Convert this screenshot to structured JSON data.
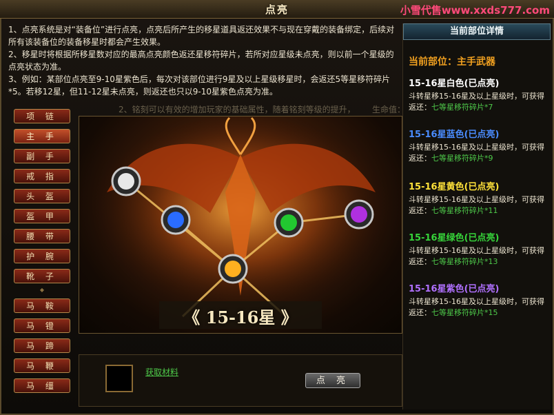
{
  "window": {
    "title": "点亮",
    "watermark": "小雪代售www.xxds777.com"
  },
  "description": [
    "1、点亮系统是对“装备位”进行点亮，点亮后所产生的移星道具返还效果不与现在穿戴的装备绑定，后续对所有该装备位的装备移星时都会产生效果。",
    "2、移星时将根据所移星数对应的最高点亮颜色返还星移符碎片，若所对应星级未点亮，则以前一个星级的点亮状态为准。",
    "3、例如：某部位点亮至9-10星紫色后，每次对该部位进行9星及以上星级移星时，会返还5等星移符碎片*5。若移12星，但11-12星未点亮，则返还也只以9-10星紫色点亮为准。"
  ],
  "ghost_lines": [
    "2、铭刻可以有效的增加玩家的基础属性，随着铭刻等级的提升，",
    "生命值：",
    "铭刻"
  ],
  "slots": {
    "top": [
      "项 链",
      "主 手",
      "副 手",
      "戒 指",
      "头 盔",
      "盔 甲",
      "腰 带",
      "护 腕",
      "靴 子"
    ],
    "bottom": [
      "马 鞍",
      "马 镫",
      "马 蹄",
      "马 鞭",
      "马 缰"
    ],
    "active_index": 1
  },
  "stage": {
    "label": "《 15-16星 》"
  },
  "material": {
    "link": "获取材料"
  },
  "action": {
    "light_button": "点 亮"
  },
  "details": {
    "header": "当前部位详情",
    "current_part": "当前部位：主手武器",
    "entries": [
      {
        "title": "15-16星白色(已点亮)",
        "color": "#ffffff",
        "line": "斗转星移15-16星及以上星级时，可获得返还：",
        "reward": "七等星移符碎片*7"
      },
      {
        "title": "15-16星蓝色(已点亮)",
        "color": "#4a8cff",
        "line": "斗转星移15-16星及以上星级时，可获得返还：",
        "reward": "七等星移符碎片*9"
      },
      {
        "title": "15-16星黄色(已点亮)",
        "color": "#ffe23a",
        "line": "斗转星移15-16星及以上星级时，可获得返还：",
        "reward": "七等星移符碎片*11"
      },
      {
        "title": "15-16星绿色(已点亮)",
        "color": "#36d43a",
        "line": "斗转星移15-16星及以上星级时，可获得返还：",
        "reward": "七等星移符碎片*13"
      },
      {
        "title": "15-16星紫色(已点亮)",
        "color": "#b070ff",
        "line": "斗转星移15-16星及以上星级时，可获得返还：",
        "reward": "七等星移符碎片*15"
      }
    ]
  },
  "gems": [
    {
      "name": "white-gem",
      "color": "#e8e8e8"
    },
    {
      "name": "blue-gem",
      "color": "#2a6cff"
    },
    {
      "name": "yellow-gem",
      "color": "#ffb020"
    },
    {
      "name": "green-gem",
      "color": "#22c830"
    },
    {
      "name": "purple-gem",
      "color": "#b030e0"
    }
  ]
}
